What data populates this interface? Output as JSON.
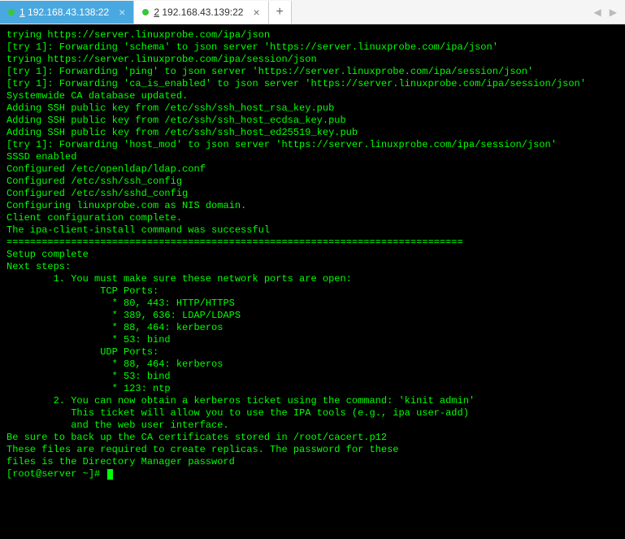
{
  "tabs": [
    {
      "num": "1",
      "label": "192.168.43.138:22",
      "active": true
    },
    {
      "num": "2",
      "label": "192.168.43.139:22",
      "active": false
    }
  ],
  "terminal_lines": [
    "trying https://server.linuxprobe.com/ipa/json",
    "[try 1]: Forwarding 'schema' to json server 'https://server.linuxprobe.com/ipa/json'",
    "trying https://server.linuxprobe.com/ipa/session/json",
    "[try 1]: Forwarding 'ping' to json server 'https://server.linuxprobe.com/ipa/session/json'",
    "[try 1]: Forwarding 'ca_is_enabled' to json server 'https://server.linuxprobe.com/ipa/session/json'",
    "Systemwide CA database updated.",
    "Adding SSH public key from /etc/ssh/ssh_host_rsa_key.pub",
    "Adding SSH public key from /etc/ssh/ssh_host_ecdsa_key.pub",
    "Adding SSH public key from /etc/ssh/ssh_host_ed25519_key.pub",
    "[try 1]: Forwarding 'host_mod' to json server 'https://server.linuxprobe.com/ipa/session/json'",
    "SSSD enabled",
    "Configured /etc/openldap/ldap.conf",
    "Configured /etc/ssh/ssh_config",
    "Configured /etc/ssh/sshd_config",
    "Configuring linuxprobe.com as NIS domain.",
    "Client configuration complete.",
    "The ipa-client-install command was successful",
    "",
    "==============================================================================",
    "Setup complete",
    "",
    "Next steps:",
    "        1. You must make sure these network ports are open:",
    "                TCP Ports:",
    "                  * 80, 443: HTTP/HTTPS",
    "                  * 389, 636: LDAP/LDAPS",
    "                  * 88, 464: kerberos",
    "                  * 53: bind",
    "                UDP Ports:",
    "                  * 88, 464: kerberos",
    "                  * 53: bind",
    "                  * 123: ntp",
    "",
    "        2. You can now obtain a kerberos ticket using the command: 'kinit admin'",
    "           This ticket will allow you to use the IPA tools (e.g., ipa user-add)",
    "           and the web user interface.",
    "",
    "Be sure to back up the CA certificates stored in /root/cacert.p12",
    "These files are required to create replicas. The password for these",
    "files is the Directory Manager password"
  ],
  "prompt": "[root@server ~]# "
}
